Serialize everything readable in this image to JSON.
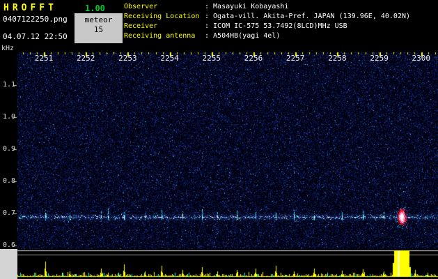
{
  "app": {
    "title": "HROFFT",
    "version": "1.00",
    "filename": "0407122250.png",
    "mode_label": "meteor",
    "echo_count": "15",
    "datetime": "04.07.12 22:50"
  },
  "info": {
    "rows": [
      {
        "label": "Observer",
        "value": ": Masayuki Kobayashi"
      },
      {
        "label": "Receiving Location",
        "value": ": Ogata-vill. Akita-Pref. JAPAN (139.96E, 40.02N)"
      },
      {
        "label": "Receiver",
        "value": ": ICOM IC-575 53.7492(8LCD)MHz USB"
      },
      {
        "label": "Receiving antenna",
        "value": ": A504HB(yagi 4el)"
      }
    ]
  },
  "chart_data": {
    "type": "heatmap",
    "subtype": "radio-meteor-spectrogram",
    "ylabel": "kHz",
    "ylabel_ticks": [
      "1.1",
      "1.0",
      "0.9",
      "0.8",
      "0.7",
      "0.6"
    ],
    "xlabel_ticks": [
      "2251",
      "2252",
      "2253",
      "2254",
      "2255",
      "2256",
      "2257",
      "2258",
      "2259",
      "2300"
    ],
    "x_start": "2250",
    "x_end": "2300",
    "carrier_freq_khz": 0.7,
    "meteor_echo_count": 15,
    "main_echo": {
      "t": 0.914,
      "freq_khz": 0.7,
      "saturated": true
    },
    "minor_echoes": [
      {
        "t": 0.066,
        "h": 10,
        "amp": 22
      },
      {
        "t": 0.124,
        "h": 6,
        "amp": 8
      },
      {
        "t": 0.199,
        "h": 8,
        "amp": 12
      },
      {
        "t": 0.215,
        "h": 12,
        "amp": 6
      },
      {
        "t": 0.253,
        "h": 9,
        "amp": 18
      },
      {
        "t": 0.303,
        "h": 6,
        "amp": 8
      },
      {
        "t": 0.343,
        "h": 10,
        "amp": 16
      },
      {
        "t": 0.392,
        "h": 8,
        "amp": 10
      },
      {
        "t": 0.439,
        "h": 11,
        "amp": 14
      },
      {
        "t": 0.475,
        "h": 7,
        "amp": 8
      },
      {
        "t": 0.521,
        "h": 9,
        "amp": 10
      },
      {
        "t": 0.566,
        "h": 8,
        "amp": 12
      },
      {
        "t": 0.614,
        "h": 7,
        "amp": 16
      },
      {
        "t": 0.657,
        "h": 9,
        "amp": 8
      },
      {
        "t": 0.705,
        "h": 8,
        "amp": 12
      },
      {
        "t": 0.771,
        "h": 7,
        "amp": 9
      },
      {
        "t": 0.821,
        "h": 9,
        "amp": 11
      },
      {
        "t": 0.871,
        "h": 7,
        "amp": 8
      }
    ],
    "extra_amp_peaks": [
      {
        "t": 0.945,
        "amp": 10
      },
      {
        "t": 0.975,
        "amp": 6
      }
    ]
  },
  "colors": {
    "title_yellow": "#ffff00",
    "version_green": "#00cc33",
    "label_yellow": "#ffff00",
    "value_white": "#ffffff",
    "panel_gray": "#c8c8c8",
    "noise_blue": "#102a66",
    "echo_cyan": "#00ffff",
    "echo_red": "#ff2040",
    "amplitude_yellow": "#ffff00"
  }
}
